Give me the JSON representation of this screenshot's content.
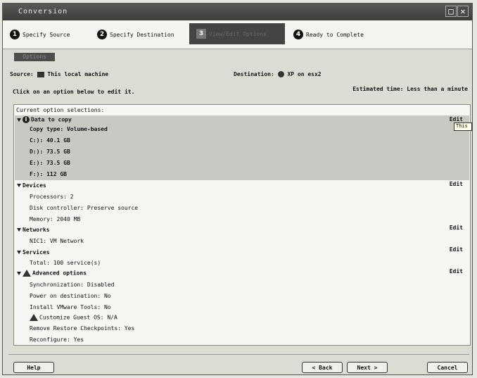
{
  "window": {
    "title": "Conversion"
  },
  "steps": [
    {
      "num": "1",
      "label": "Specify Source"
    },
    {
      "num": "2",
      "label": "Specify Destination"
    },
    {
      "num": "3",
      "label": "View/Edit Options"
    },
    {
      "num": "4",
      "label": "Ready to Complete"
    }
  ],
  "subtab": "Options",
  "source": {
    "label": "Source:",
    "value": "This local machine"
  },
  "destination": {
    "label": "Destination:",
    "value": "XP on esx2"
  },
  "instruction": "Click on an option below to edit it.",
  "estimated": "Estimated time: Less than a minute",
  "panel": {
    "header": "Current option selections:",
    "edit_label": "Edit",
    "tooltip": "This c",
    "data_to_copy": {
      "title": "Data to copy",
      "copy_type": "Copy type: Volume-based",
      "volumes": [
        "C:): 40.1 GB",
        "D:): 73.5 GB",
        "E:): 73.5 GB",
        "F:): 112 GB"
      ]
    },
    "devices": {
      "title": "Devices",
      "items": [
        "Processors: 2",
        "Disk controller: Preserve source",
        "Memory: 2040 MB"
      ]
    },
    "networks": {
      "title": "Networks",
      "items": [
        "NIC1: VM Network"
      ]
    },
    "services": {
      "title": "Services",
      "items": [
        "Total: 100 service(s)"
      ]
    },
    "advanced": {
      "title": "Advanced options",
      "items": [
        "Synchronization: Disabled",
        "Power on destination: No",
        "Install VMware Tools: No",
        "Customize Guest OS: N/A",
        "Remove Restore Checkpoints: Yes",
        "Reconfigure: Yes"
      ]
    }
  },
  "buttons": {
    "help": "Help",
    "back": "< Back",
    "next": "Next >",
    "cancel": "Cancel"
  }
}
